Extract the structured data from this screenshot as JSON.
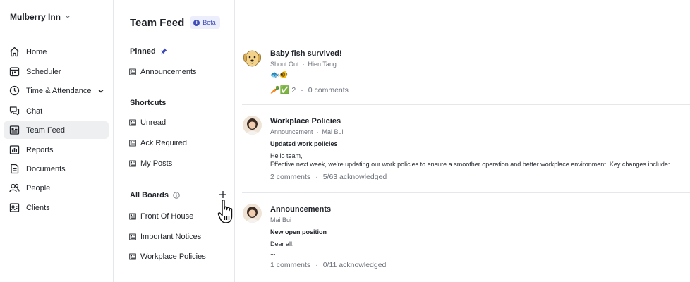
{
  "sidebar": {
    "org_name": "Mulberry Inn",
    "items": [
      {
        "label": "Home",
        "icon": "home-icon"
      },
      {
        "label": "Scheduler",
        "icon": "calendar-icon"
      },
      {
        "label": "Time & Attendance",
        "icon": "clock-icon"
      },
      {
        "label": "Chat",
        "icon": "chat-icon"
      },
      {
        "label": "Team Feed",
        "icon": "feed-icon",
        "active": true
      },
      {
        "label": "Reports",
        "icon": "chart-icon"
      },
      {
        "label": "Documents",
        "icon": "document-icon"
      },
      {
        "label": "People",
        "icon": "people-icon"
      },
      {
        "label": "Clients",
        "icon": "contact-card-icon"
      }
    ]
  },
  "boards": {
    "title": "Team Feed",
    "badge": "Beta",
    "pinned_label": "Pinned",
    "pinned": [
      "Announcements"
    ],
    "shortcuts_label": "Shortcuts",
    "shortcuts": [
      "Unread",
      "Ack Required",
      "My Posts"
    ],
    "all_boards_label": "All Boards",
    "all_boards": [
      "Front Of House",
      "Important Notices",
      "Workplace Policies"
    ]
  },
  "feed": {
    "posts": [
      {
        "title": "Baby fish survived!",
        "board": "Shout Out",
        "author": "Hien Tang",
        "emojis": "🐟🐠",
        "reactions": "🥕✅",
        "reaction_count": "2",
        "comments": "0 comments"
      },
      {
        "title": "Workplace Policies",
        "board": "Announcement",
        "author": "Mai Bui",
        "subject": "Updated work policies",
        "body": [
          "Hello team,",
          "Effective next week, we're updating our work policies to ensure a smoother operation and better workplace environment. Key changes include:..."
        ],
        "comments": "2 comments",
        "acknowledged": "5/63 acknowledged"
      },
      {
        "title": "Announcements",
        "author": "Mai Bui",
        "subject": "New open position",
        "body": [
          "Dear all,",
          "..."
        ],
        "comments": "1 comments",
        "acknowledged": "0/11 acknowledged"
      }
    ]
  },
  "colors": {
    "accent": "#3e4bb8",
    "active_nav_bg": "#eeeff1",
    "muted_text": "#6b7079"
  }
}
